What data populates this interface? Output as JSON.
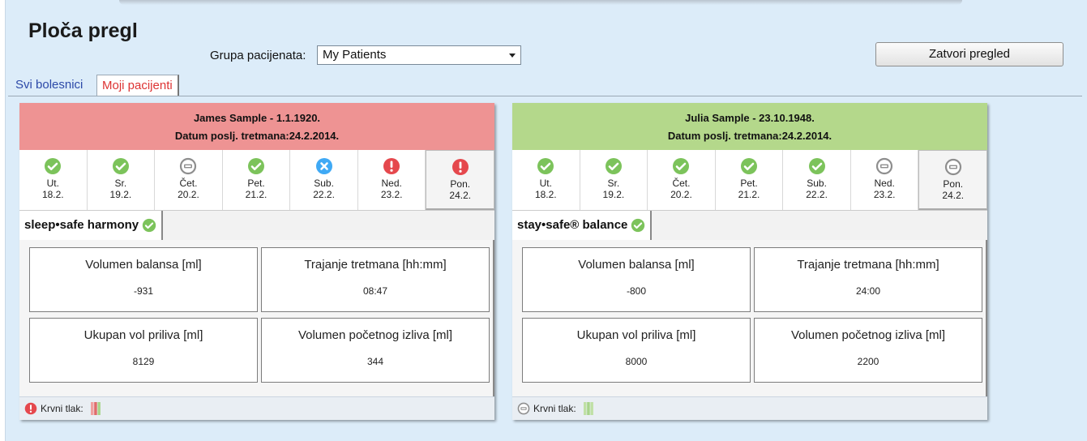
{
  "page": {
    "title": "Ploča pregl"
  },
  "filter": {
    "label": "Grupa pacijenata:",
    "selected": "My Patients"
  },
  "close_button": "Zatvori pregled",
  "tabs": [
    {
      "label": "Svi bolesnici"
    },
    {
      "label": "Moji pacijenti"
    }
  ],
  "colors": {
    "card_red": "#ee9393",
    "card_green": "#b4d88b",
    "ok": "#7cc35b",
    "error": "#e5484d",
    "neutral": "#8e8e8e",
    "cancel": "#3fa9f5"
  },
  "patients": [
    {
      "name_line": "James Sample - 1.1.1920.",
      "last_treatment": "Datum poslj. tretmana:24.2.2014.",
      "days": [
        {
          "name": "Ut.",
          "date": "18.2.",
          "status": "check-icon"
        },
        {
          "name": "Sr.",
          "date": "19.2.",
          "status": "check-icon"
        },
        {
          "name": "Čet.",
          "date": "20.2.",
          "status": "minus-icon"
        },
        {
          "name": "Pet.",
          "date": "21.2.",
          "status": "check-icon"
        },
        {
          "name": "Sub.",
          "date": "22.2.",
          "status": "x-icon"
        },
        {
          "name": "Ned.",
          "date": "23.2.",
          "status": "exclamation-icon"
        },
        {
          "name": "Pon.",
          "date": "24.2.",
          "status": "exclamation-icon"
        }
      ],
      "program": "sleep•safe harmony",
      "metrics": [
        {
          "label": "Volumen balansa [ml]",
          "value": "-931"
        },
        {
          "label": "Trajanje tretmana [hh:mm]",
          "value": "08:47"
        },
        {
          "label": "Ukupan vol priliva [ml]",
          "value": "8129"
        },
        {
          "label": "Volumen početnog izliva [ml]",
          "value": "344"
        }
      ],
      "bp_label": "Krvni tlak:"
    },
    {
      "name_line": "Julia Sample - 23.10.1948.",
      "last_treatment": "Datum poslj. tretmana:24.2.2014.",
      "days": [
        {
          "name": "Ut.",
          "date": "18.2.",
          "status": "check-icon"
        },
        {
          "name": "Sr.",
          "date": "19.2.",
          "status": "check-icon"
        },
        {
          "name": "Čet.",
          "date": "20.2.",
          "status": "check-icon"
        },
        {
          "name": "Pet.",
          "date": "21.2.",
          "status": "check-icon"
        },
        {
          "name": "Sub.",
          "date": "22.2.",
          "status": "check-icon"
        },
        {
          "name": "Ned.",
          "date": "23.2.",
          "status": "minus-icon"
        },
        {
          "name": "Pon.",
          "date": "24.2.",
          "status": "minus-icon"
        }
      ],
      "program": "stay•safe® balance",
      "metrics": [
        {
          "label": "Volumen balansa [ml]",
          "value": "-800"
        },
        {
          "label": "Trajanje tretmana [hh:mm]",
          "value": "24:00"
        },
        {
          "label": "Ukupan vol priliva [ml]",
          "value": "8000"
        },
        {
          "label": "Volumen početnog izliva [ml]",
          "value": "2200"
        }
      ],
      "bp_label": "Krvni tlak:"
    }
  ]
}
